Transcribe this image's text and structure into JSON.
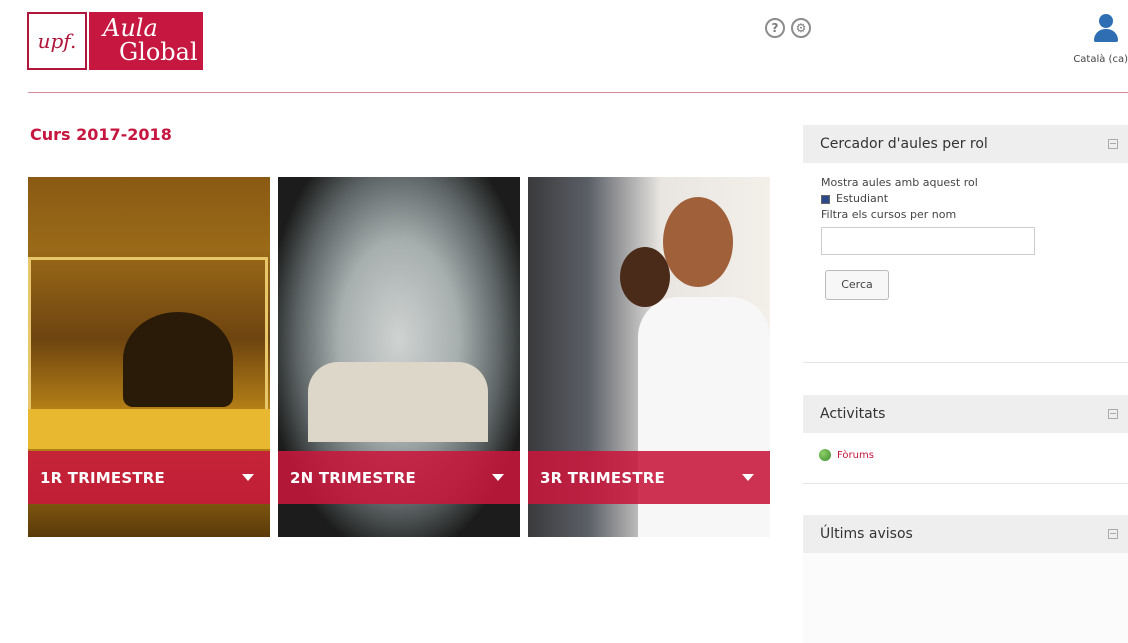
{
  "header": {
    "logo": {
      "upf": "upf.",
      "aula": "Aula",
      "global": "Global"
    },
    "help_icon": "question-circle",
    "settings_icon": "gear-circle",
    "user_icon": "person-icon",
    "language": "Català (ca)"
  },
  "main": {
    "course_title": "Curs 2017-2018",
    "tiles": [
      {
        "label": "1R TRIMESTRE"
      },
      {
        "label": "2N TRIMESTRE"
      },
      {
        "label": "3R TRIMESTRE"
      }
    ]
  },
  "sidebar": {
    "search_block": {
      "title": "Cercador d'aules per rol",
      "role_label": "Mostra aules amb aquest rol",
      "role_option": "Estudiant",
      "filter_label": "Filtra els cursos per nom",
      "filter_value": "",
      "button": "Cerca"
    },
    "activities_block": {
      "title": "Activitats",
      "link": "Fòrums"
    },
    "notices_block": {
      "title": "Últims avisos"
    }
  },
  "colors": {
    "brand": "#c5173f",
    "header_band": "#eeeeee"
  }
}
